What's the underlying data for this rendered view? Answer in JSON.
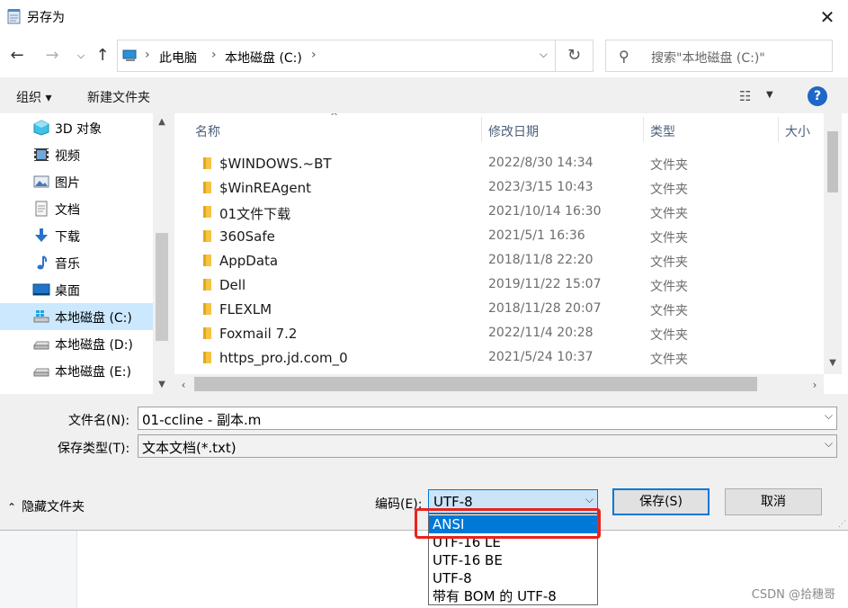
{
  "window": {
    "title": "另存为"
  },
  "address": {
    "crumbs": [
      "此电脑",
      "本地磁盘 (C:)"
    ],
    "search_placeholder": "搜索\"本地磁盘 (C:)\""
  },
  "toolbar": {
    "organize": "组织 ▾",
    "new_folder": "新建文件夹",
    "help": "?"
  },
  "nav_pane": {
    "items": [
      {
        "label": "3D 对象",
        "icon": "cube-3d-icon"
      },
      {
        "label": "视频",
        "icon": "video-icon"
      },
      {
        "label": "图片",
        "icon": "picture-icon"
      },
      {
        "label": "文档",
        "icon": "document-icon"
      },
      {
        "label": "下载",
        "icon": "download-icon"
      },
      {
        "label": "音乐",
        "icon": "music-icon"
      },
      {
        "label": "桌面",
        "icon": "desktop-icon"
      },
      {
        "label": "本地磁盘 (C:)",
        "icon": "windows-drive-icon",
        "selected": true
      },
      {
        "label": "本地磁盘 (D:)",
        "icon": "drive-icon"
      },
      {
        "label": "本地磁盘 (E:)",
        "icon": "drive-icon"
      }
    ]
  },
  "file_list": {
    "columns": [
      "名称",
      "修改日期",
      "类型",
      "大小"
    ],
    "rows": [
      {
        "name": "$WINDOWS.~BT",
        "date": "2022/8/30 14:34",
        "type": "文件夹"
      },
      {
        "name": "$WinREAgent",
        "date": "2023/3/15 10:43",
        "type": "文件夹"
      },
      {
        "name": "01文件下载",
        "date": "2021/10/14 16:30",
        "type": "文件夹"
      },
      {
        "name": "360Safe",
        "date": "2021/5/1 16:36",
        "type": "文件夹"
      },
      {
        "name": "AppData",
        "date": "2018/11/8 22:20",
        "type": "文件夹"
      },
      {
        "name": "Dell",
        "date": "2019/11/22 15:07",
        "type": "文件夹"
      },
      {
        "name": "FLEXLM",
        "date": "2018/11/28 20:07",
        "type": "文件夹"
      },
      {
        "name": "Foxmail 7.2",
        "date": "2022/11/4 20:28",
        "type": "文件夹"
      },
      {
        "name": "https_pro.jd.com_0",
        "date": "2021/5/24 10:37",
        "type": "文件夹"
      }
    ]
  },
  "form": {
    "filename_label": "文件名(N):",
    "filename_value": "01-ccline - 副本.m",
    "filetype_label": "保存类型(T):",
    "filetype_value": "文本文档(*.txt)",
    "hide_folders": "隐藏文件夹",
    "encoding_label": "编码(E):",
    "encoding_value": "UTF-8",
    "save_button": "保存(S)",
    "cancel_button": "取消"
  },
  "encoding_options": [
    "ANSI",
    "UTF-16 LE",
    "UTF-16 BE",
    "UTF-8",
    "带有 BOM 的 UTF-8"
  ],
  "encoding_highlighted": "ANSI",
  "watermark": "CSDN @拾穗哥",
  "colors": {
    "accent": "#0078d7",
    "selection": "#cce8ff",
    "annotation": "#e8231c"
  }
}
